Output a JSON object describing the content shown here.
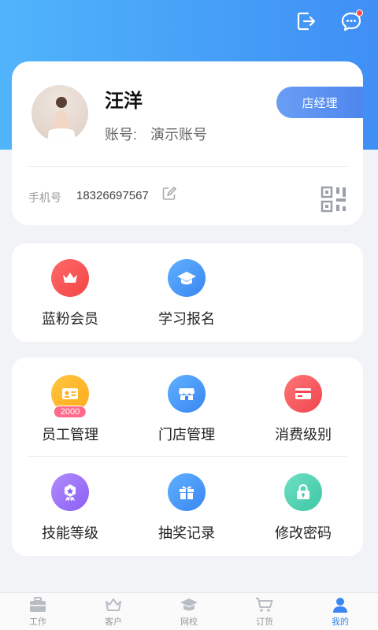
{
  "header": {
    "logout_icon": "logout-icon",
    "message_icon": "message-icon",
    "message_has_unread": true
  },
  "profile": {
    "name": "汪洋",
    "account_label": "账号:",
    "account_value": "演示账号",
    "role": "店经理",
    "phone_label": "手机号",
    "phone": "18326697567"
  },
  "section_a": {
    "items": [
      {
        "label": "蓝粉会员",
        "icon": "crown-icon",
        "color": "#f24444"
      },
      {
        "label": "学习报名",
        "icon": "graduation-cap-icon",
        "color": "#3a86f2"
      }
    ]
  },
  "section_b": {
    "items": [
      {
        "label": "员工管理",
        "icon": "id-card-icon",
        "badge": "2000",
        "color": "#ffab1c"
      },
      {
        "label": "门店管理",
        "icon": "store-icon",
        "color": "#3a86f2"
      },
      {
        "label": "消费级别",
        "icon": "card-icon",
        "color": "#f1454f"
      },
      {
        "label": "技能等级",
        "icon": "medal-icon",
        "color": "#8a5ef2"
      },
      {
        "label": "抽奖记录",
        "icon": "gift-icon",
        "color": "#3a86f2"
      },
      {
        "label": "修改密码",
        "icon": "lock-icon",
        "color": "#3dc7a6"
      }
    ]
  },
  "tabbar": {
    "tabs": [
      {
        "label": "工作",
        "icon": "briefcase-icon",
        "active": false
      },
      {
        "label": "客户",
        "icon": "crown-icon",
        "active": false
      },
      {
        "label": "网校",
        "icon": "graduation-cap-icon",
        "active": false
      },
      {
        "label": "订货",
        "icon": "cart-icon",
        "active": false
      },
      {
        "label": "我的",
        "icon": "user-icon",
        "active": true
      }
    ]
  }
}
